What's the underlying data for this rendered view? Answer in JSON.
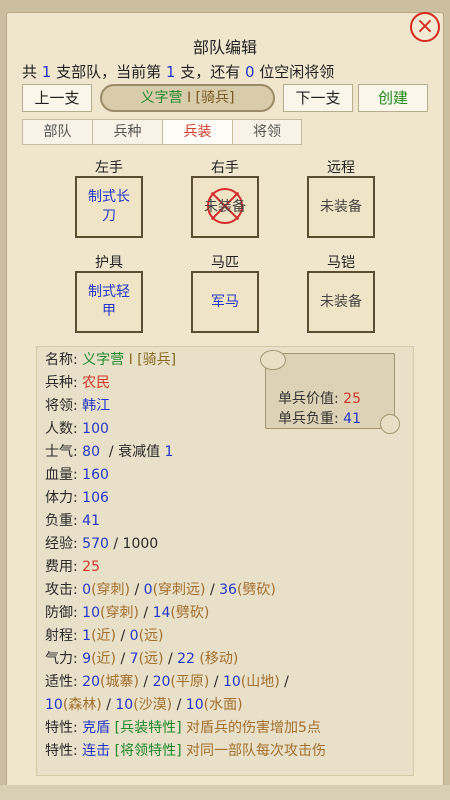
{
  "window": {
    "title": "部队编辑",
    "close_glyph": "×"
  },
  "summary": {
    "p1": "共 ",
    "total": "1",
    "p2": " 支部队，当前第 ",
    "current": "1",
    "p3": " 支，还有 ",
    "idle": "0",
    "p4": " 位空闲将领"
  },
  "nav": {
    "prev_label": "上一支",
    "next_label": "下一支",
    "create_label": "创建"
  },
  "unit": {
    "name": "义字营",
    "rank": "Ⅰ",
    "type": "[骑兵]"
  },
  "tabs": [
    {
      "label": "部队",
      "active": false
    },
    {
      "label": "兵种",
      "active": false
    },
    {
      "label": "兵装",
      "active": true
    },
    {
      "label": "将领",
      "active": false
    }
  ],
  "equipment": {
    "left_hand": {
      "label": "左手",
      "item": "制式长刀",
      "equipped": true
    },
    "right_hand": {
      "label": "右手",
      "item": "未装备",
      "equipped": false,
      "stamp": "x-stamp-icon"
    },
    "ranged": {
      "label": "远程",
      "item": "未装备",
      "equipped": false
    },
    "armor": {
      "label": "护具",
      "item": "制式轻甲",
      "equipped": true
    },
    "horse": {
      "label": "马匹",
      "item": "军马",
      "equipped": true
    },
    "barding": {
      "label": "马铠",
      "item": "未装备",
      "equipped": false
    }
  },
  "scroll": {
    "value_label": "单兵价值:",
    "value": "25",
    "load_label": "单兵负重:",
    "load": "41"
  },
  "stats": {
    "name_label": "名称:",
    "name": "义字营",
    "rank": "Ⅰ",
    "type": "[骑兵]",
    "troop_label": "兵种:",
    "troop": "农民",
    "general_label": "将领:",
    "general": "韩江",
    "count_label": "人数:",
    "count": "100",
    "morale_label": "士气:",
    "morale": "80",
    "decay_label": "/ 衰减值",
    "decay": "1",
    "hp_label": "血量:",
    "hp": "160",
    "stamina_label": "体力:",
    "stamina": "106",
    "load_label": "负重:",
    "load": "41",
    "exp_label": "经验:",
    "exp": "570",
    "exp_sep": "/",
    "exp_max": "1000",
    "cost_label": "费用:",
    "cost": "25",
    "attack_label": "攻击:",
    "atk1": "0",
    "atk1_t": "(穿刺)",
    "atk2": "0",
    "atk2_t": "(穿刺远)",
    "atk3": "36",
    "atk3_t": "(劈砍)",
    "defense_label": "防御:",
    "def1": "10",
    "def1_t": "(穿刺)",
    "def2": "14",
    "def2_t": "(劈砍)",
    "range_label": "射程:",
    "rng1": "1",
    "rng1_t": "(近)",
    "rng2": "0",
    "rng2_t": "(远)",
    "qi_label": "气力:",
    "qi1": "9",
    "qi1_t": "(近)",
    "qi2": "7",
    "qi2_t": "(远)",
    "qi3": "22",
    "qi3_t": "(移动)",
    "adapt_label": "适性:",
    "ad1": "20",
    "ad1_t": "(城寨)",
    "ad2": "20",
    "ad2_t": "(平原)",
    "ad3": "10",
    "ad3_t": "(山地)",
    "ad4": "10",
    "ad4_t": "(森林)",
    "ad5": "10",
    "ad5_t": "(沙漠)",
    "ad6": "10",
    "ad6_t": "(水面)",
    "trait1_label": "特性:",
    "trait1_name": "克盾",
    "trait1_tag": "[兵装特性]",
    "trait1_desc": "对盾兵的伤害增加5点",
    "trait2_label": "特性:",
    "trait2_name": "连击",
    "trait2_tag": "[将领特性]",
    "trait2_desc": "对同一部队每次攻击伤"
  }
}
